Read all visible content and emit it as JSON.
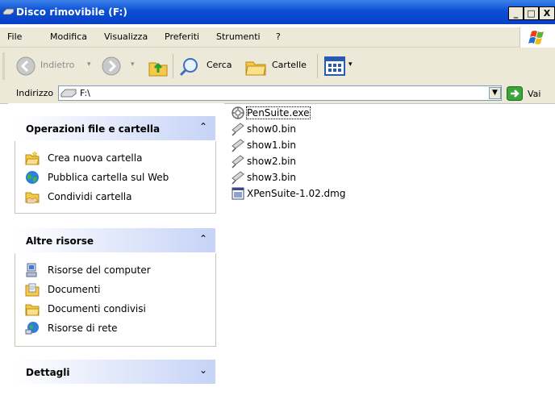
{
  "window": {
    "title": "Disco rimovibile (F:)",
    "min_label": "_",
    "max_label": "□",
    "close_label": "X"
  },
  "menu": {
    "items": [
      "File",
      "Modifica",
      "Visualizza",
      "Preferiti",
      "Strumenti",
      "?"
    ]
  },
  "toolbar": {
    "back_label": "Indietro",
    "search_label": "Cerca",
    "folders_label": "Cartelle"
  },
  "address": {
    "label": "Indirizzo",
    "value": "F:\\",
    "go_label": "Vai"
  },
  "panels": [
    {
      "title": "Operazioni file e cartella",
      "collapsed": false,
      "items": [
        {
          "label": "Crea nuova cartella",
          "icon": "new-folder-icon"
        },
        {
          "label": "Pubblica cartella sul Web",
          "icon": "web-publish-icon"
        },
        {
          "label": "Condividi cartella",
          "icon": "share-folder-icon"
        }
      ]
    },
    {
      "title": "Altre risorse",
      "collapsed": false,
      "items": [
        {
          "label": "Risorse del computer",
          "icon": "my-computer-icon"
        },
        {
          "label": "Documenti",
          "icon": "documents-icon"
        },
        {
          "label": "Documenti condivisi",
          "icon": "shared-documents-icon"
        },
        {
          "label": "Risorse di rete",
          "icon": "network-icon"
        }
      ]
    },
    {
      "title": "Dettagli",
      "collapsed": true,
      "items": []
    }
  ],
  "files": [
    {
      "name": "PenSuite.exe",
      "icon": "exe-icon",
      "focused": true
    },
    {
      "name": "show0.bin",
      "icon": "bin-file-icon"
    },
    {
      "name": "show1.bin",
      "icon": "bin-file-icon"
    },
    {
      "name": "show2.bin",
      "icon": "bin-file-icon"
    },
    {
      "name": "show3.bin",
      "icon": "bin-file-icon"
    },
    {
      "name": "XPenSuite-1.02.dmg",
      "icon": "dmg-file-icon"
    }
  ],
  "colors": {
    "titlebar": "#0a4fd6",
    "chrome": "#ece9d8",
    "panel_head": "#c6d3f7"
  }
}
